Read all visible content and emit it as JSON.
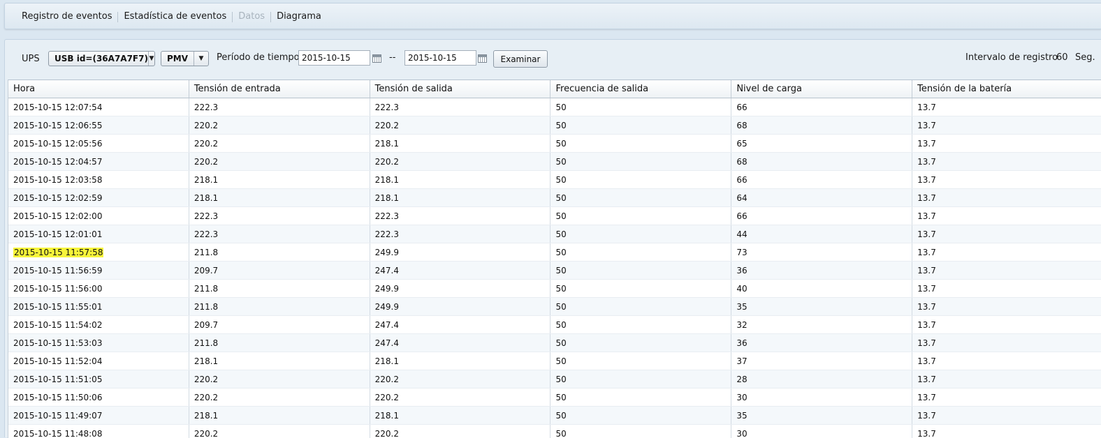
{
  "tabs": [
    {
      "label": "Registro de eventos",
      "disabled": false
    },
    {
      "label": "Estadística de eventos",
      "disabled": false
    },
    {
      "label": "Datos",
      "disabled": true
    },
    {
      "label": "Diagrama",
      "disabled": false
    }
  ],
  "toolbar": {
    "ups_label": "UPS",
    "device_value": "USB id=(36A7A7F7)",
    "type_value": "PMV",
    "period_label": "Período de tiempo",
    "date_from": "2015-10-15",
    "separator": "--",
    "date_to": "2015-10-15",
    "examine_label": "Examinar",
    "interval_label": "Intervalo de registro",
    "interval_value": "60",
    "interval_unit": "Seg."
  },
  "table": {
    "columns": [
      "Hora",
      "Tensión de entrada",
      "Tensión de salida",
      "Frecuencia de salida",
      "Nivel de carga",
      "Tensión de la batería"
    ],
    "highlight_color": "#f7f53a",
    "rows": [
      [
        "2015-10-15 12:07:54",
        "222.3",
        "222.3",
        "50",
        "66",
        "13.7"
      ],
      [
        "2015-10-15 12:06:55",
        "220.2",
        "220.2",
        "50",
        "68",
        "13.7"
      ],
      [
        "2015-10-15 12:05:56",
        "220.2",
        "218.1",
        "50",
        "65",
        "13.7"
      ],
      [
        "2015-10-15 12:04:57",
        "220.2",
        "220.2",
        "50",
        "68",
        "13.7"
      ],
      [
        "2015-10-15 12:03:58",
        "218.1",
        "218.1",
        "50",
        "66",
        "13.7"
      ],
      [
        "2015-10-15 12:02:59",
        "218.1",
        "218.1",
        "50",
        "64",
        "13.7"
      ],
      [
        "2015-10-15 12:02:00",
        "222.3",
        "222.3",
        "50",
        "66",
        "13.7"
      ],
      [
        "2015-10-15 12:01:01",
        "222.3",
        "222.3",
        "50",
        "44",
        "13.7"
      ],
      [
        "2015-10-15 11:57:58",
        "211.8",
        "249.9",
        "50",
        "73",
        "13.7"
      ],
      [
        "2015-10-15 11:56:59",
        "209.7",
        "247.4",
        "50",
        "36",
        "13.7"
      ],
      [
        "2015-10-15 11:56:00",
        "211.8",
        "249.9",
        "50",
        "40",
        "13.7"
      ],
      [
        "2015-10-15 11:55:01",
        "211.8",
        "249.9",
        "50",
        "35",
        "13.7"
      ],
      [
        "2015-10-15 11:54:02",
        "209.7",
        "247.4",
        "50",
        "32",
        "13.7"
      ],
      [
        "2015-10-15 11:53:03",
        "211.8",
        "247.4",
        "50",
        "36",
        "13.7"
      ],
      [
        "2015-10-15 11:52:04",
        "218.1",
        "218.1",
        "50",
        "37",
        "13.7"
      ],
      [
        "2015-10-15 11:51:05",
        "220.2",
        "220.2",
        "50",
        "28",
        "13.7"
      ],
      [
        "2015-10-15 11:50:06",
        "220.2",
        "220.2",
        "50",
        "30",
        "13.7"
      ],
      [
        "2015-10-15 11:49:07",
        "218.1",
        "218.1",
        "50",
        "35",
        "13.7"
      ],
      [
        "2015-10-15 11:48:08",
        "220.2",
        "220.2",
        "50",
        "30",
        "13.7"
      ]
    ],
    "highlighted_row": 8
  }
}
